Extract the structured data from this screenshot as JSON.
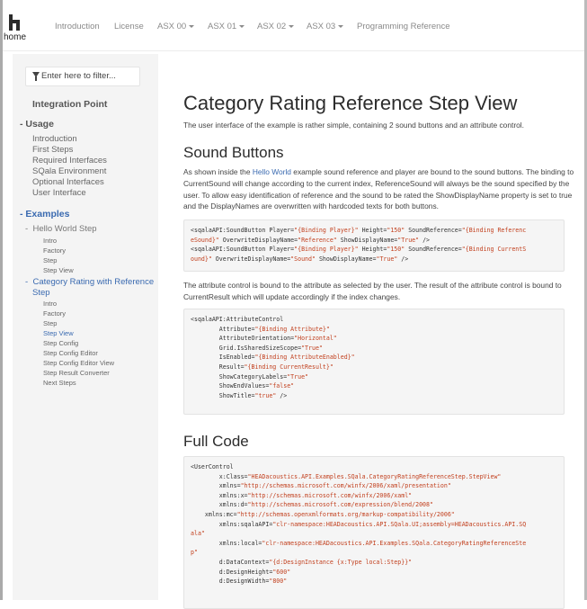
{
  "nav": {
    "home_label": "home",
    "items": [
      "Introduction",
      "License",
      "ASX 00",
      "ASX 01",
      "ASX 02",
      "ASX 03",
      "Programming Reference"
    ]
  },
  "sidebar": {
    "filter_placeholder": "Enter here to filter...",
    "title": "Integration Point",
    "usage": {
      "label": "Usage",
      "items": [
        "Introduction",
        "First Steps",
        "Required Interfaces",
        "SQala Environment",
        "Optional Interfaces",
        "User Interface"
      ]
    },
    "examples": {
      "label": "Examples",
      "hello": {
        "label": "Hello World Step",
        "items": [
          "Intro",
          "Factory",
          "Step",
          "Step View"
        ]
      },
      "category": {
        "label_line1": "Category Rating with Reference",
        "label_line2": "Step",
        "items": [
          "Intro",
          "Factory",
          "Step",
          "Step View",
          "Step Config",
          "Step Config Editor",
          "Step Config Editor View",
          "Step Result Converter",
          "Next Steps"
        ],
        "active_item": "Step View"
      }
    }
  },
  "main": {
    "title": "Category Rating Reference Step View",
    "intro": "The user interface of the example is rather simple, containing 2 sound buttons and an attribute control.",
    "sound_heading": "Sound Buttons",
    "sound_p_prefix": "As shown inside the ",
    "sound_p_link": "Hello World",
    "sound_p_rest": " example sound reference and player are bound to the sound buttons. The binding to CurrentSound will change according to the current index, ReferenceSound will always be the sound specified by the user. To allow easy identification of reference and the sound to be rated the ShowDisplayName property is set to true and the DisplayNames are overwritten with hardcoded texts for both buttons.",
    "attr_p": "The attribute control is bound to the attribute as selected by the user. The result of the attribute control is bound to CurrentResult which will update accordingly if the index changes.",
    "full_heading": "Full Code"
  },
  "colors": {
    "accent": "#3a6ab0",
    "string": "#c2401e",
    "sidebar_bg": "#f4f4f4",
    "code_bg": "#f5f5f5"
  }
}
